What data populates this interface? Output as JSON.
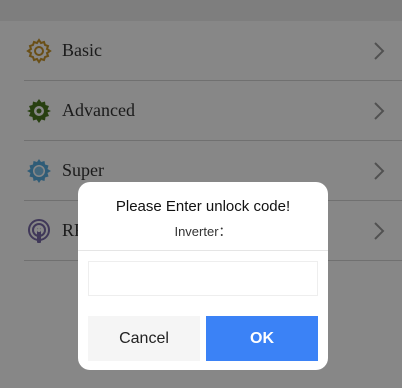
{
  "menu": {
    "items": [
      {
        "label": "Basic",
        "icon": "gear-outline-icon",
        "color": "#c9962b"
      },
      {
        "label": "Advanced",
        "icon": "gear-solid-icon",
        "color": "#4c7a1f"
      },
      {
        "label": "Super",
        "icon": "gear-blue-icon",
        "color": "#5aaee0"
      },
      {
        "label": "RF Control",
        "icon": "remote-control-icon",
        "color": "#7a6aa8"
      }
    ],
    "chevron_icon": "chevron-right-icon"
  },
  "dialog": {
    "title": "Please Enter unlock code!",
    "subtitle": "Inverter：",
    "input_value": "",
    "input_placeholder": "",
    "cancel_label": "Cancel",
    "ok_label": "OK",
    "ok_color": "#3b82f6"
  },
  "colors": {
    "overlay": "rgba(0,0,0,0.47)"
  }
}
